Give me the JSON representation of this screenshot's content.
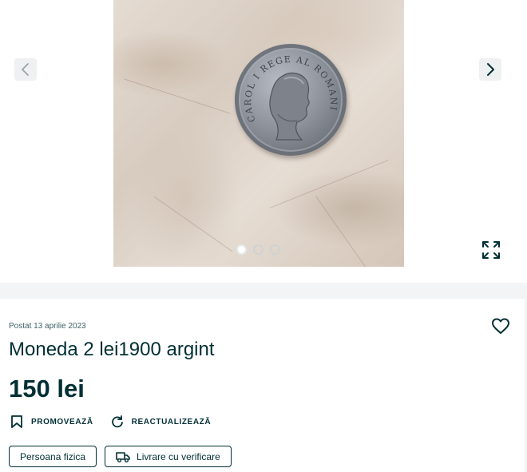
{
  "gallery": {
    "image_count": 3,
    "active_index": 0,
    "coin_inscription": "CAROL I REGE AL ROMANIEI"
  },
  "ad": {
    "posted": "Postat 13 aprilie 2023",
    "title": "Moneda 2 lei1900 argint",
    "price": "150 lei",
    "actions": {
      "promote": "PROMOVEAZĂ",
      "refresh": "REACTUALIZEAZĂ"
    },
    "tags": {
      "seller_type": "Persoana fizica",
      "delivery": "Livrare cu verificare"
    }
  },
  "icons": {
    "prev": "chevron-left-icon",
    "next": "chevron-right-icon",
    "fullscreen": "expand-icon",
    "favorite": "heart-icon",
    "promote": "bookmark-icon",
    "refresh": "refresh-icon",
    "delivery": "truck-icon"
  },
  "colors": {
    "primary_text": "#002f34",
    "page_bg": "#f2f4f5",
    "card_bg": "#ffffff"
  }
}
